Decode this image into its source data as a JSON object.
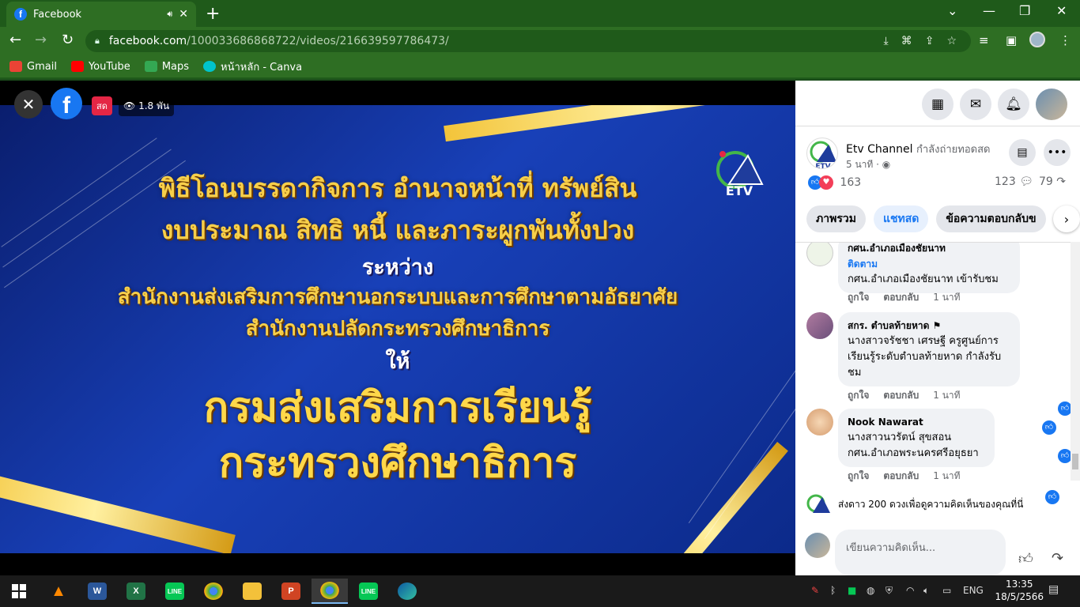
{
  "browser": {
    "tab_title": "Facebook",
    "new_tab": "+",
    "url_host": "facebook.com",
    "url_path": "/100033686868722/videos/216639597786473/",
    "bookmarks": [
      {
        "label": "Gmail",
        "color": "#ea4335"
      },
      {
        "label": "YouTube",
        "color": "#ff0000"
      },
      {
        "label": "Maps",
        "color": "#34a853"
      },
      {
        "label": "หน้าหลัก - Canva",
        "color": "#00c4cc"
      }
    ]
  },
  "video": {
    "live_label": "สด",
    "views": "1.8 พัน",
    "lines": [
      "พิธีโอนบรรดากิจการ อำนาจหน้าที่ ทรัพย์สิน",
      "งบประมาณ สิทธิ หนี้ และภาระผูกพันทั้งปวง",
      "ระหว่าง",
      "สำนักงานส่งเสริมการศึกษานอกระบบและการศึกษาตามอัธยาศัย",
      "สำนักงานปลัดกระทรวงศึกษาธิการ",
      "ให้",
      "กรมส่งเสริมการเรียนรู้",
      "กระทรวงศึกษาธิการ"
    ],
    "logo_text": "ETV"
  },
  "post": {
    "page_name": "Etv Channel",
    "status": "กำลังถ่ายทอดสด",
    "time": "5 นาที · ",
    "reactions": "163",
    "comments_count": "123",
    "shares_count": "79"
  },
  "tabs": [
    "ภาพรวม",
    "แชทสด",
    "ข้อความตอบกลับข"
  ],
  "comments": [
    {
      "name": "กศน.อำเภอเมืองชัยนาท",
      "follow": "ติดตาม",
      "text": "กศน.อำเภอเมืองชัยนาท เข้ารับชม",
      "like": "ถูกใจ",
      "reply": "ตอบกลับ",
      "time": "1 นาที"
    },
    {
      "name": "สกร. ตำบลท้ายหาด",
      "text": "นางสาวจรัชชา เศรษฐี ครูศูนย์การเรียนรู้ระดับตำบลท้ายหาด กำลังรับชม",
      "like": "ถูกใจ",
      "reply": "ตอบกลับ",
      "time": "1 นาที"
    },
    {
      "name": "Nook Nawarat",
      "text": "นางสาวนวรัตน์ สุขสอน กศน.อำเภอพระนครศรีอยุธยา",
      "like": "ถูกใจ",
      "reply": "ตอบกลับ",
      "time": "1 นาที"
    }
  ],
  "stars_prompt": "ส่งดาว 200 ดวงเพื่อดูความคิดเห็นของคุณที่นี่",
  "compose_placeholder": "เขียนความคิดเห็น...",
  "taskbar": {
    "time": "13:35",
    "date": "18/5/2566",
    "lang": "ENG"
  },
  "colors": {
    "browser_dark": "#1f5a1a",
    "browser": "#2e6e23",
    "fb_blue": "#1877f2",
    "video_gold": "#f7cf4a"
  }
}
